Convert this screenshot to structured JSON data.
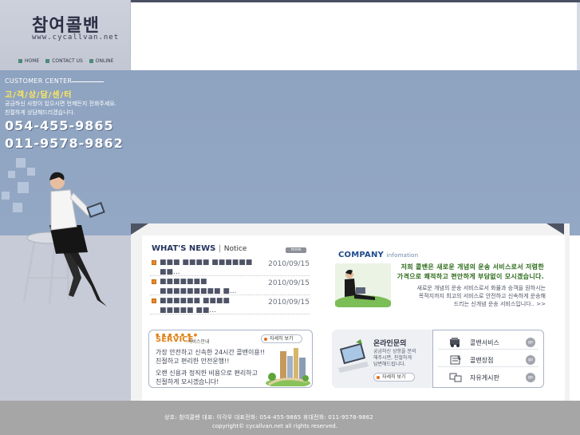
{
  "logo": {
    "name": "참여콜밴",
    "url": "www.cycallvan.net"
  },
  "top_nav": [
    {
      "label": "HOME"
    },
    {
      "label": "CONTACT US"
    },
    {
      "label": "ONLINE"
    }
  ],
  "customer_center": {
    "title_en": "CUSTOMER CENTER",
    "title_ko": "고/객/상/담/센/터",
    "desc_line1": "궁금하신 사항이 있으시면 언제든지 전화주세요.",
    "desc_line2": "친절하게 상담해드리겠습니다.",
    "phone1": "054-455-9865",
    "phone2": "011-9578-9862"
  },
  "news": {
    "title": "WHAT'S NEWS",
    "separator": "|",
    "subtitle": "Notice",
    "more_label": "more",
    "items": [
      {
        "text": "■■■ ■■■■ ■■■■■■ ■■...",
        "date": "2010/09/15"
      },
      {
        "text": "■■■■■■■ ■■■■■■■■■ ■...",
        "date": "2010/09/15"
      },
      {
        "text": "■■■■■■ ■■■■ ■■■■■ ■■...",
        "date": "2010/09/15"
      }
    ]
  },
  "company": {
    "title": "COMPANY",
    "info": "infomation",
    "slogan_line1": "저희 콜밴은 새로운 개념의 운송 서비스로서 저렴한",
    "slogan_line2": "가격으로 쾌적하고 편안하게 부담없이 모시겠습니다.",
    "desc_line1": "새로운 개념의 운송 서비스로서 화물과 승객을 원하시는",
    "desc_line2": "목적지까지 최고의 서비스로 안전하고 신속하게 운송해",
    "desc_line3": "드리는 신개념 운송 서비스입니다.. >>"
  },
  "service": {
    "dots": "● ● ● ● ● ● ●",
    "title": "SERVICE",
    "subtitle": "서비스안내",
    "detail_label": "자세히 보기",
    "line1": "가장 안전하고 신속한 24시간 콜밴이용!!",
    "line2": "친절하고 편리한 안전운행!!",
    "line3": "오랜 신용과 정직한 비용으로 편리하고",
    "line4": "친절하게 모시겠습니다!"
  },
  "inquiry": {
    "title": "온라인문의",
    "line1": "궁금하신 상항을 문의",
    "line2": "해주시면, 친절하게",
    "line3": "답변해드립니다.",
    "detail_label": "자세히 보기"
  },
  "quick_links": [
    {
      "label": "콜밴서비스",
      "icon": "van-icon",
      "go": "go"
    },
    {
      "label": "콜밴장점",
      "icon": "note-icon",
      "go": "go"
    },
    {
      "label": "자유게시판",
      "icon": "chat-icon",
      "go": "go"
    }
  ],
  "footer": {
    "line1": "상호: 참여콜밴    대표: 이각우    대표전화: 054-455-9865    휴대전화: 011-9578-9862",
    "line2": "copyright© cycallvan.net  all rights reserved."
  },
  "colors": {
    "band": "#8ea3c0",
    "left_column": "#c8ccd8",
    "accent_yellow": "#ffe85a",
    "news_title": "#24345e",
    "company_title": "#1f4a8c",
    "service_orange": "#e0821a",
    "footer": "#a6a6a6"
  }
}
